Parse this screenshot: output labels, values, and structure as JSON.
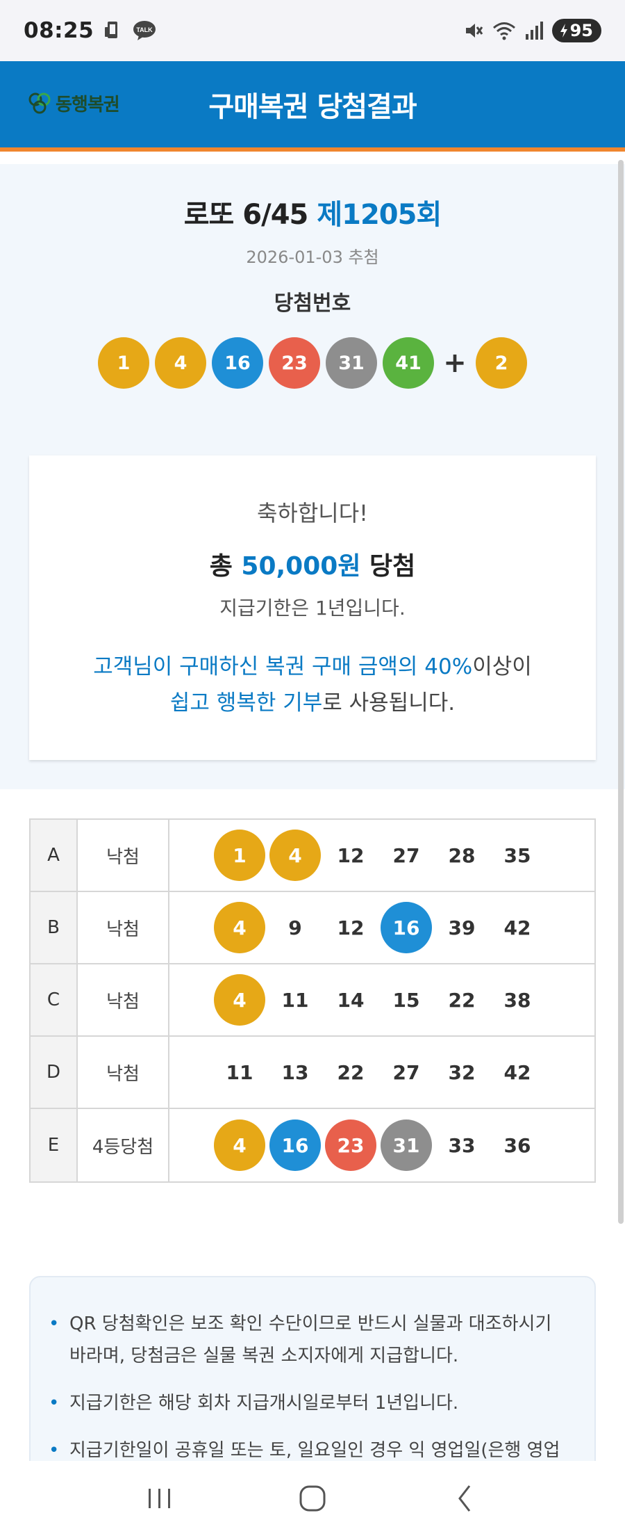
{
  "status_bar": {
    "time": "08:25",
    "talk_badge": "TALK",
    "battery": "95",
    "icons": [
      "phone-icon",
      "talk-icon",
      "mute-icon",
      "wifi-icon",
      "signal-icon",
      "charging-icon"
    ]
  },
  "header": {
    "logo_text": "동행복권",
    "title": "구매복권 당첨결과"
  },
  "draw": {
    "game": "로또 6/45",
    "round": "제1205회",
    "date": "2026-01-03 추첨",
    "winning_label": "당첨번호",
    "numbers": [
      "1",
      "4",
      "16",
      "23",
      "31",
      "41"
    ],
    "plus": "+",
    "bonus": "2"
  },
  "ball_colors": {
    "yellow": "#e6a817",
    "blue": "#1f8fd6",
    "red": "#e8604c",
    "gray": "#8e8e8e",
    "green": "#5ab33f"
  },
  "result": {
    "congrats": "축하합니다!",
    "total_prefix": "총",
    "total_amount": "50,000원",
    "total_suffix": "당첨",
    "deadline": "지급기한은 1년입니다.",
    "donation_line1_hl": "고객님이 구매하신 복권 구매 금액의 40%",
    "donation_line1_rest": "이상이",
    "donation_line2_hl": "쉽고 행복한 기부",
    "donation_line2_rest": "로 사용됩니다."
  },
  "tickets": [
    {
      "label": "A",
      "result": "낙첨",
      "numbers": [
        {
          "v": "1",
          "c": "yellow"
        },
        {
          "v": "4",
          "c": "yellow"
        },
        {
          "v": "12"
        },
        {
          "v": "27"
        },
        {
          "v": "28"
        },
        {
          "v": "35"
        }
      ]
    },
    {
      "label": "B",
      "result": "낙첨",
      "numbers": [
        {
          "v": "4",
          "c": "yellow"
        },
        {
          "v": "9"
        },
        {
          "v": "12"
        },
        {
          "v": "16",
          "c": "blue"
        },
        {
          "v": "39"
        },
        {
          "v": "42"
        }
      ]
    },
    {
      "label": "C",
      "result": "낙첨",
      "numbers": [
        {
          "v": "4",
          "c": "yellow"
        },
        {
          "v": "11"
        },
        {
          "v": "14"
        },
        {
          "v": "15"
        },
        {
          "v": "22"
        },
        {
          "v": "38"
        }
      ]
    },
    {
      "label": "D",
      "result": "낙첨",
      "numbers": [
        {
          "v": "11"
        },
        {
          "v": "13"
        },
        {
          "v": "22"
        },
        {
          "v": "27"
        },
        {
          "v": "32"
        },
        {
          "v": "42"
        }
      ]
    },
    {
      "label": "E",
      "result": "4등당첨",
      "numbers": [
        {
          "v": "4",
          "c": "yellow"
        },
        {
          "v": "16",
          "c": "blue"
        },
        {
          "v": "23",
          "c": "red"
        },
        {
          "v": "31",
          "c": "gray"
        },
        {
          "v": "33"
        },
        {
          "v": "36"
        }
      ]
    }
  ],
  "notice": {
    "bullet": "•",
    "items": [
      "QR 당첨확인은 보조 확인 수단이므로 반드시 실물과 대조하시기 바라며, 당첨금은 실물 복권 소지자에게 지급합니다.",
      "지급기한은 해당 회차 지급개시일로부터 1년입니다.",
      "지급기한일이 공휴일 또는 토, 일요일인 경우 익 영업일(은행 영업"
    ]
  },
  "nav": {
    "buttons": [
      "recent-apps-icon",
      "home-icon",
      "back-icon"
    ]
  }
}
